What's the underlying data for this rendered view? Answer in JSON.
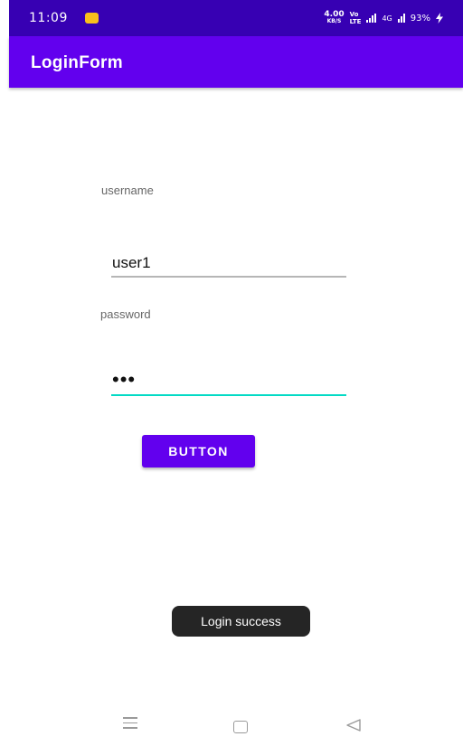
{
  "status_bar": {
    "time": "11:09",
    "net_speed_value": "4.00",
    "net_speed_unit": "KB/S",
    "vo_label": "Vo",
    "lte_label": "LTE",
    "network_type": "4G",
    "battery_percent": "93%"
  },
  "app_bar": {
    "title": "LoginForm"
  },
  "form": {
    "username_label": "username",
    "username_value": "user1",
    "password_label": "password",
    "password_masked": "•••",
    "button_label": "BUTTON"
  },
  "toast": {
    "message": "Login success"
  },
  "colors": {
    "status_bar": "#3700B3",
    "primary": "#6200EE",
    "accent": "#03DAC5",
    "toast_bg": "#252525"
  },
  "nav_bar": {
    "icons": [
      "menu-icon",
      "home-icon",
      "back-icon"
    ]
  }
}
